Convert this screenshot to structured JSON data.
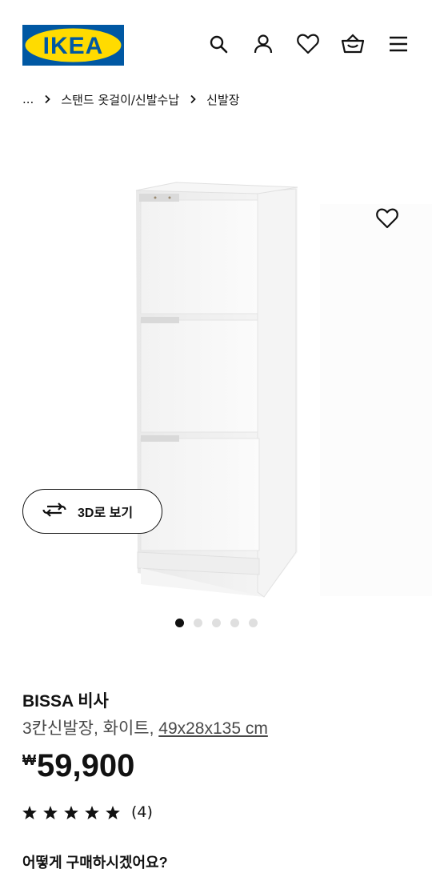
{
  "header": {
    "logo_text": "IKEA",
    "brand_blue": "#0058A3",
    "brand_yellow": "#FFDB00",
    "icons": [
      "search-icon",
      "user-icon",
      "heart-icon",
      "basket-icon",
      "menu-icon"
    ]
  },
  "breadcrumb": {
    "items": [
      "...",
      "스탠드 옷걸이/신발수납",
      "신발장"
    ]
  },
  "gallery": {
    "view_3d_label": "3D로 보기",
    "slide_count": 5,
    "active_slide": 1
  },
  "product": {
    "name": "BISSA 비사",
    "description": "3칸신발장, 화이트, ",
    "dimensions": "49x28x135 cm",
    "currency": "₩",
    "price": "59,900",
    "rating": 5,
    "review_count": "(4)"
  },
  "purchase": {
    "heading": "어떻게 구매하시겠어요?"
  }
}
